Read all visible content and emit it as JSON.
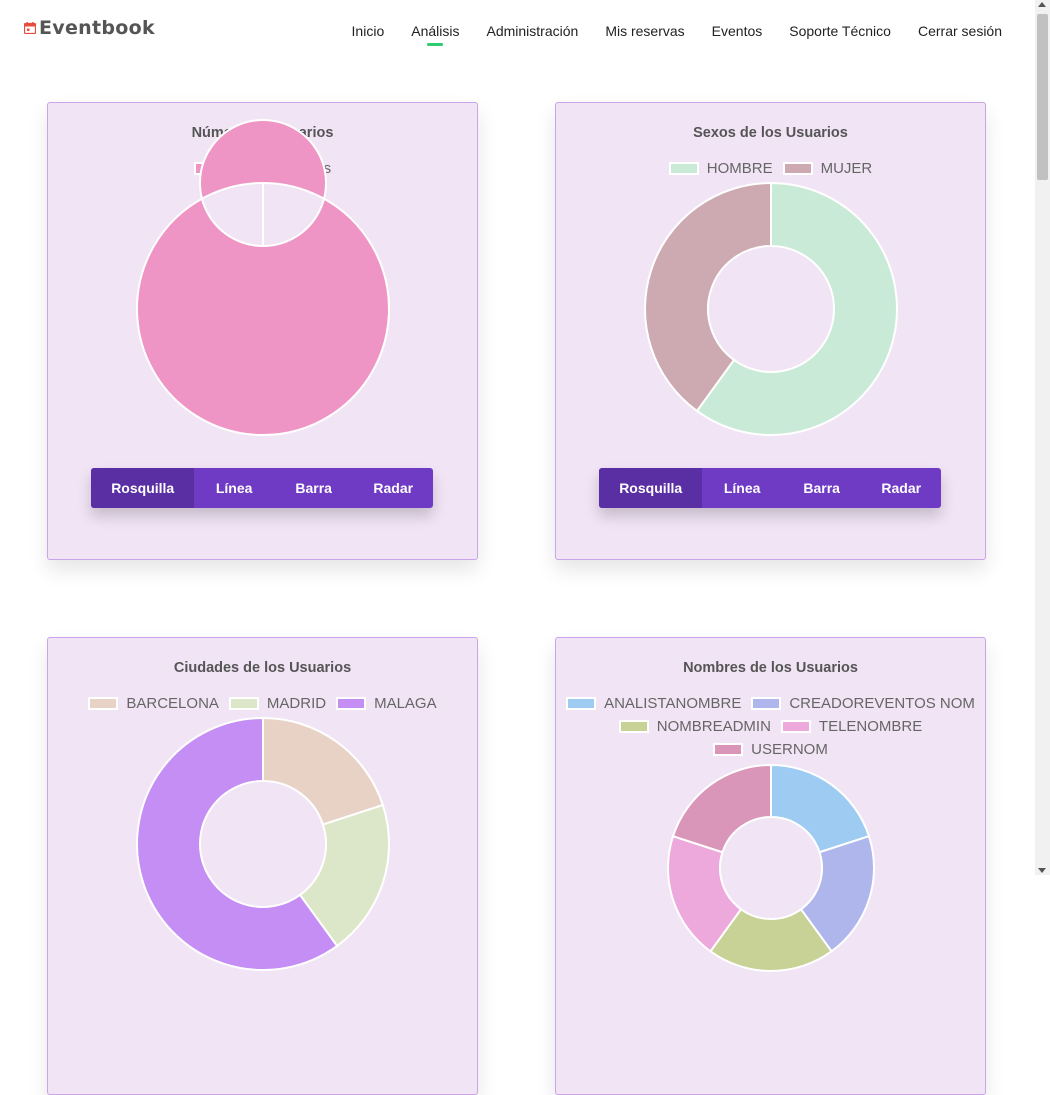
{
  "brand": {
    "name": "Eventbook"
  },
  "nav": {
    "items": [
      {
        "label": "Inicio",
        "active": false
      },
      {
        "label": "Análisis",
        "active": true
      },
      {
        "label": "Administración",
        "active": false
      },
      {
        "label": "Mis reservas",
        "active": false
      },
      {
        "label": "Eventos",
        "active": false
      },
      {
        "label": "Soporte Técnico",
        "active": false
      },
      {
        "label": "Cerrar sesión",
        "active": false
      }
    ]
  },
  "chart_buttons": [
    "Rosquilla",
    "Línea",
    "Barra",
    "Radar"
  ],
  "chart_data": [
    {
      "type": "doughnut",
      "title": "Número de Usuarios",
      "categories": [
        "Num. Usuarios"
      ],
      "values": [
        1
      ],
      "colors": [
        "#ef95c5"
      ],
      "selected_type": "Rosquilla"
    },
    {
      "type": "doughnut",
      "title": "Sexos de los Usuarios",
      "categories": [
        "HOMBRE",
        "MUJER"
      ],
      "values": [
        60,
        40
      ],
      "colors": [
        "#c9ead6",
        "#cdaab1"
      ],
      "selected_type": "Rosquilla"
    },
    {
      "type": "doughnut",
      "title": "Ciudades de los Usuarios",
      "categories": [
        "BARCELONA",
        "MADRID",
        "MALAGA"
      ],
      "values": [
        20,
        20,
        60
      ],
      "colors": [
        "#e7d2c5",
        "#dbe7c8",
        "#c48ef4"
      ]
    },
    {
      "type": "doughnut",
      "title": "Nombres de los Usuarios",
      "categories": [
        "ANALISTANOMBRE",
        "CREADOREVENTOS NOM",
        "NOMBREADMIN",
        "TELENOMBRE",
        "USERNOM"
      ],
      "values": [
        20,
        20,
        20,
        20,
        20
      ],
      "colors": [
        "#9dcbf1",
        "#aeb6ec",
        "#c8d196",
        "#eda8dc",
        "#da96b8"
      ]
    }
  ]
}
